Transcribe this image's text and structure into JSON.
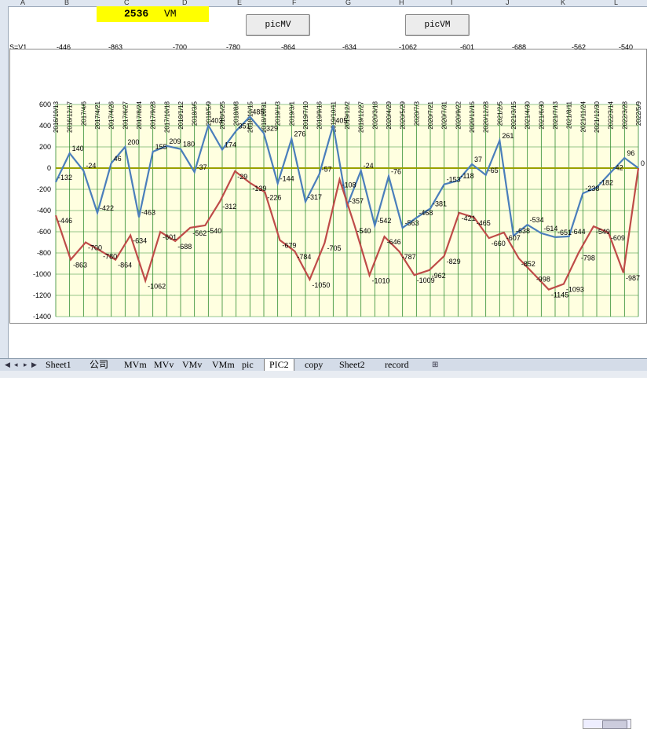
{
  "header": {
    "columns": [
      "A",
      "B",
      "C",
      "D",
      "E",
      "F",
      "G",
      "H",
      "I",
      "J",
      "K",
      "L"
    ],
    "vm_value": "2536",
    "vm_unit": "VM",
    "btn_mv": "picMV",
    "btn_vm": "picVM",
    "row_label": "S=V1",
    "row_values": [
      "-446",
      "-863",
      "-700",
      "-780",
      "-864",
      "-634",
      "-1062",
      "-601",
      "-688",
      "-562",
      "-540"
    ]
  },
  "tabs": [
    "Sheet1",
    "公司",
    "MVm",
    "MVv",
    "VMv",
    "VMm",
    "pic",
    "PIC2",
    "copy",
    "Sheet2",
    "record"
  ],
  "active_tab": "PIC2",
  "chart_data": {
    "type": "line",
    "ylim": [
      -1400,
      600
    ],
    "yticks": [
      600,
      400,
      200,
      0,
      -200,
      -400,
      -600,
      -800,
      -1000,
      -1200,
      -1400
    ],
    "x": [
      "2016/10/13",
      "2016/12/17",
      "2017/4/6",
      "2017/4/21",
      "2017/4/26",
      "2017/6/27",
      "2017/8/24",
      "2017/9/28",
      "2017/10/18",
      "2018/1/12",
      "2018/3/5",
      "2018/5/9",
      "2018/5/25",
      "2018/8/8",
      "2018/10/15",
      "2018/10/31",
      "2019/1/3",
      "2019/3/1",
      "2019/7/10",
      "2019/9/16",
      "2019/10/11",
      "2019/12/2",
      "2019/12/27",
      "2020/3/18",
      "2020/4/29",
      "2020/5/29",
      "2020/7/3",
      "2020/7/21",
      "2020/7/31",
      "2020/9/22",
      "2020/12/15",
      "2020/12/28",
      "2021/2/5",
      "2021/3/15",
      "2021/4/30",
      "2021/6/30",
      "2021/7/13",
      "2021/8/11",
      "2021/11/24",
      "2021/12/30",
      "2022/3/14",
      "2022/3/28",
      "2022/5/9"
    ],
    "series": [
      {
        "color": "#4a7ebb",
        "values": [
          -132,
          140,
          -24,
          -422,
          46,
          200,
          -463,
          155,
          209,
          180,
          -37,
          403,
          174,
          351,
          485,
          329,
          -144,
          276,
          -317,
          -57,
          405,
          -357,
          -24,
          -542,
          -76,
          -563,
          -468,
          -381,
          -153,
          -118,
          37,
          -65,
          261,
          -638,
          -534,
          -614,
          -651,
          -644,
          -238,
          -182,
          -42,
          96,
          0
        ],
        "labels": [
          "-132",
          "140",
          "-24",
          "-422",
          "46",
          "200",
          "-463",
          "155",
          "209",
          "180",
          "-37",
          "403",
          "174",
          "351",
          "485",
          "329",
          "-144",
          "276",
          "-317",
          "-57",
          "405",
          "-357",
          "-24",
          "-542",
          "-76",
          "-563",
          "-468",
          "-381",
          "-153",
          "-118",
          "37",
          "-65",
          "261",
          "-638",
          "-534",
          "-614",
          "-651",
          "-644",
          "-238",
          "-182",
          "-42",
          "96",
          "0"
        ]
      },
      {
        "color": "#be4b48",
        "values": [
          -446,
          -863,
          -700,
          -780,
          -864,
          -634,
          -1062,
          -601,
          -688,
          -562,
          -540,
          -312,
          -29,
          -139,
          -226,
          -679,
          -784,
          -1050,
          -705,
          -108,
          -540,
          -1010,
          -646,
          -787,
          -1009,
          -962,
          -829,
          -421,
          -465,
          -660,
          -607,
          -852,
          -998,
          -1145,
          -1093,
          -798,
          -549,
          -609,
          -987,
          0
        ],
        "labels": [
          "-446",
          "-863",
          "-700",
          "-780",
          "-864",
          "-634",
          "-1062",
          "-601",
          "-688",
          "-562",
          "-540",
          "-312",
          "-29",
          "-139",
          "-226",
          "-679",
          "-784",
          "-1050",
          "-705",
          "-108",
          "-540",
          "-1010",
          "-646",
          "-787",
          "-1009",
          "-962",
          "-829",
          "-421",
          "-465",
          "-660",
          "-607",
          "-852",
          "-998",
          "-1145",
          "-1093",
          "-798",
          "-549",
          "-609",
          "-987",
          ""
        ]
      }
    ],
    "grid": true,
    "plot_bg": "#ffffe0",
    "grid_color": "#2e8b2e",
    "zero_line_color": "#9aa000"
  }
}
